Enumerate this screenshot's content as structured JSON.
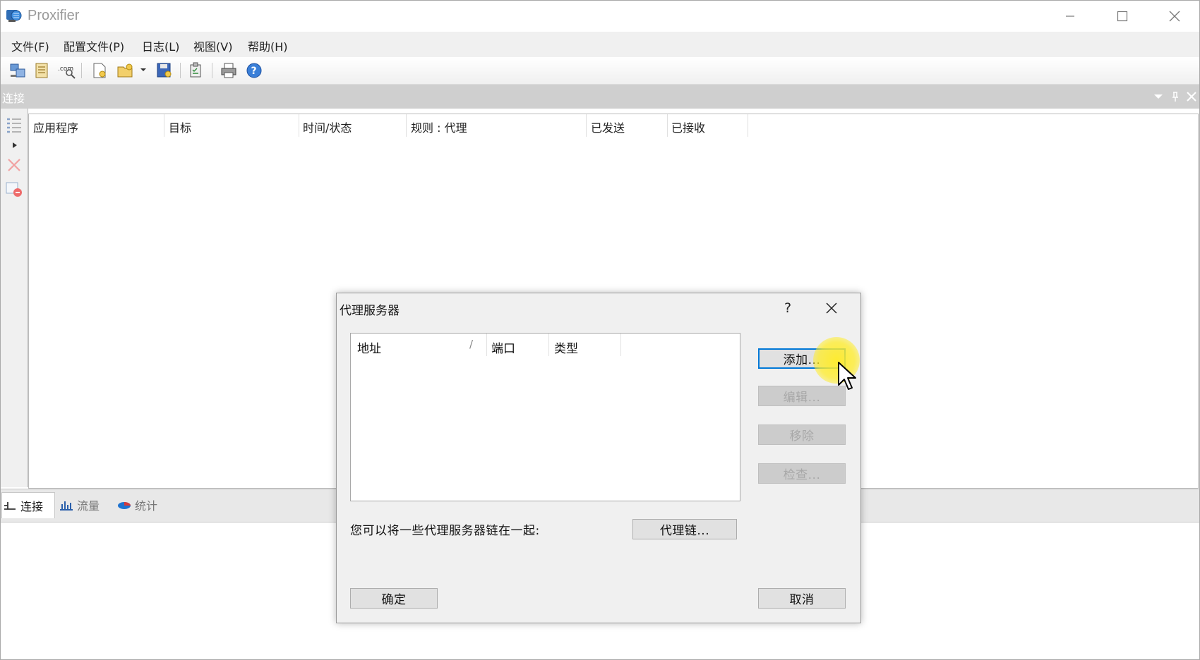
{
  "window": {
    "title": "Proxifier",
    "icon": "proxifier-app-icon"
  },
  "menu": {
    "items": [
      "文件(F)",
      "配置文件(P)",
      "日志(L)",
      "视图(V)",
      "帮助(H)"
    ]
  },
  "toolbar": {
    "icons": [
      "proxy-servers-icon",
      "proxification-rules-icon",
      "name-resolution-icon",
      "new-profile-icon",
      "open-profile-icon",
      "save-profile-icon",
      "advanced-icon",
      "print-icon",
      "help-icon"
    ]
  },
  "connections": {
    "panel_title": "连接",
    "columns": [
      "应用程序",
      "目标",
      "时间/状态",
      "规则 : 代理",
      "已发送",
      "已接收"
    ],
    "rows": []
  },
  "bottom_tabs": [
    {
      "label": "连接",
      "icon": "connections-tab-icon",
      "active": true
    },
    {
      "label": "流量",
      "icon": "traffic-tab-icon",
      "active": false
    },
    {
      "label": "统计",
      "icon": "statistics-tab-icon",
      "active": false
    }
  ],
  "dialog": {
    "title": "代理服务器",
    "help_label": "?",
    "list_columns": [
      "地址",
      "端口",
      "类型"
    ],
    "sort_indicator": "/",
    "rows": [],
    "buttons": {
      "add": "添加...",
      "edit": "编辑...",
      "remove": "移除",
      "check": "检查...",
      "chain": "代理链...",
      "ok": "确定",
      "cancel": "取消"
    },
    "chain_hint": "您可以将一些代理服务器链在一起:"
  },
  "colors": {
    "accent": "#0078d7",
    "panel_header": "#cfcfcf",
    "cursor_highlight": "#ffec28"
  }
}
